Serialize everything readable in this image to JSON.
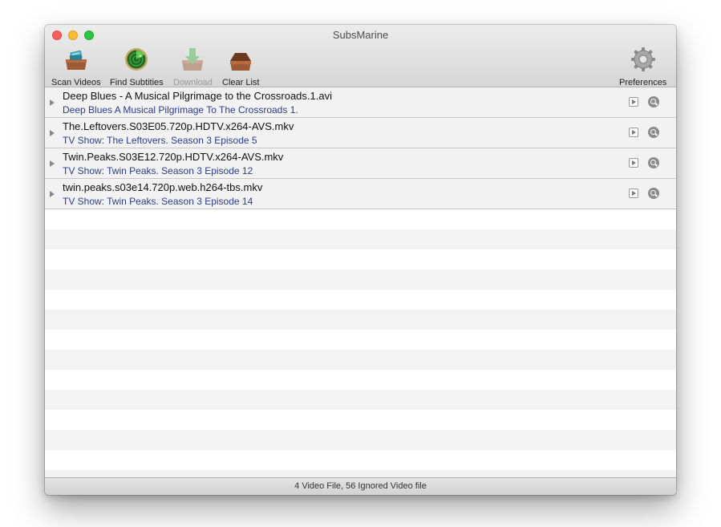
{
  "window": {
    "title": "SubsMarine"
  },
  "toolbar": {
    "scan_videos": {
      "label": "Scan Videos",
      "icon": "scan-videos-icon"
    },
    "find_subtitles": {
      "label": "Find Subtities",
      "icon": "radar-icon"
    },
    "download": {
      "label": "Download",
      "icon": "download-icon",
      "enabled": false
    },
    "clear_list": {
      "label": "Clear List",
      "icon": "inbox-tray-icon"
    },
    "preferences": {
      "label": "Preferences",
      "icon": "gear-icon"
    }
  },
  "files": [
    {
      "filename": "Deep Blues - A Musical Pilgrimage to the Crossroads.1.avi",
      "detail": "Deep Blues A Musical Pilgrimage To The Crossroads 1."
    },
    {
      "filename": "The.Leftovers.S03E05.720p.HDTV.x264-AVS.mkv",
      "detail": "TV Show: The Leftovers. Season 3 Episode 5"
    },
    {
      "filename": "Twin.Peaks.S03E12.720p.HDTV.x264-AVS.mkv",
      "detail": "TV Show: Twin Peaks. Season 3 Episode 12"
    },
    {
      "filename": "twin.peaks.s03e14.720p.web.h264-tbs.mkv",
      "detail": "TV Show: Twin Peaks. Season 3 Episode 14"
    }
  ],
  "status": {
    "text": "4 Video File, 56 Ignored Video file"
  },
  "colors": {
    "detail_text": "#2a3d8f",
    "row_bg": "#f2f2f2"
  }
}
